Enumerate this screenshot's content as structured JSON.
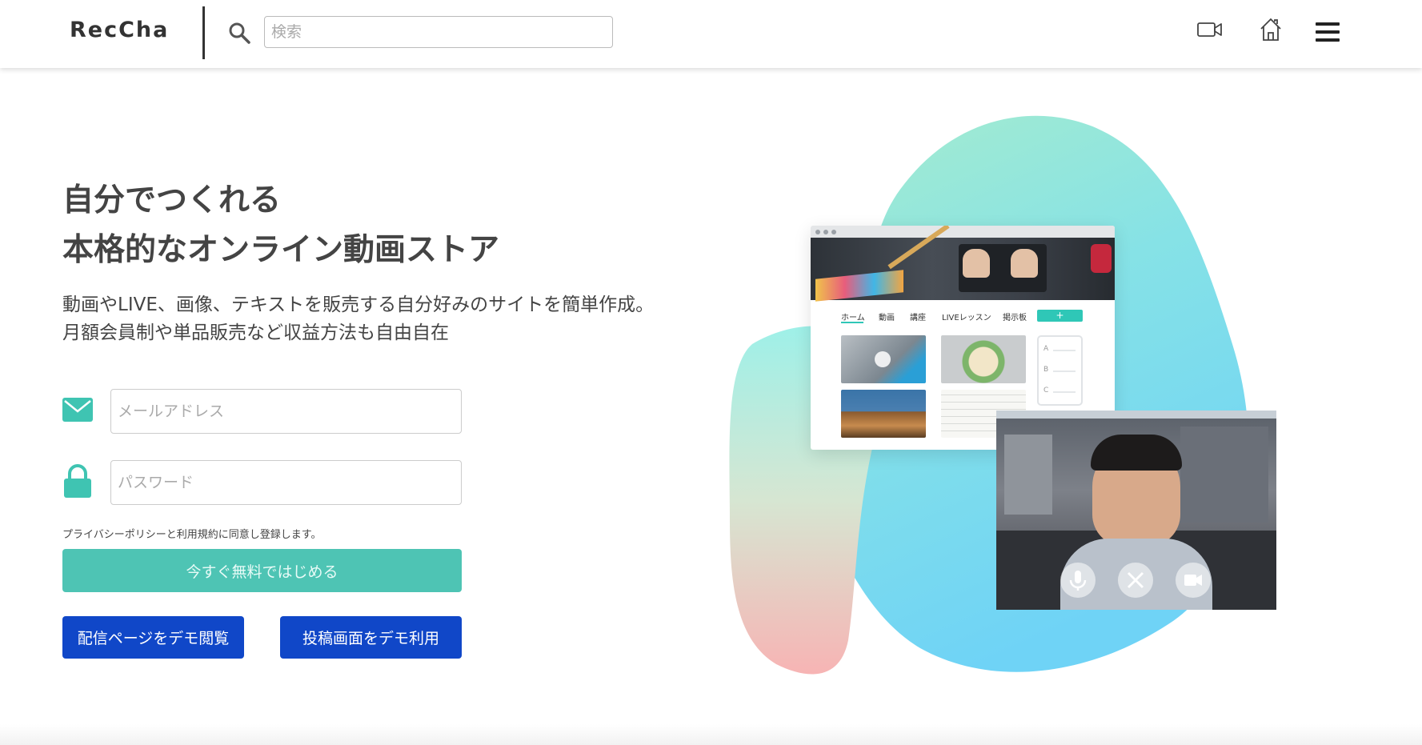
{
  "header": {
    "logo": "RecCha",
    "search_placeholder": "検索",
    "icons": [
      "search-icon",
      "video-camera-icon",
      "home-icon",
      "hamburger-menu-icon"
    ]
  },
  "hero": {
    "title_line1": "自分でつくれる",
    "title_line2": "本格的なオンライン動画ストア",
    "subtitle_line1": "動画やLIVE、画像、テキストを販売する自分好みのサイトを簡単作成。",
    "subtitle_line2": "月額会員制や単品販売など収益方法も自由自在"
  },
  "form": {
    "email_placeholder": "メールアドレス",
    "password_placeholder": "パスワード",
    "agreement_text": "プライバシーポリシーと利用規約に同意し登録します。",
    "start_button": "今すぐ無料ではじめる",
    "demo_view_button": "配信ページをデモ閲覧",
    "demo_post_button": "投稿画面をデモ利用"
  },
  "illustration": {
    "nav_tabs": [
      "ホーム",
      "動画",
      "講座",
      "LIVEレッスン",
      "掲示板"
    ],
    "plus_label": "+",
    "panel_labels": [
      "A",
      "B",
      "C"
    ],
    "video_controls": [
      "microphone-icon",
      "close-icon",
      "camera-icon"
    ]
  },
  "colors": {
    "accent_teal": "#4ec4b4",
    "demo_blue": "#1047c8",
    "blob_green": "#a8ecd0",
    "blob_blue": "#72d6f4",
    "blob_pink": "#f7b8b8"
  }
}
